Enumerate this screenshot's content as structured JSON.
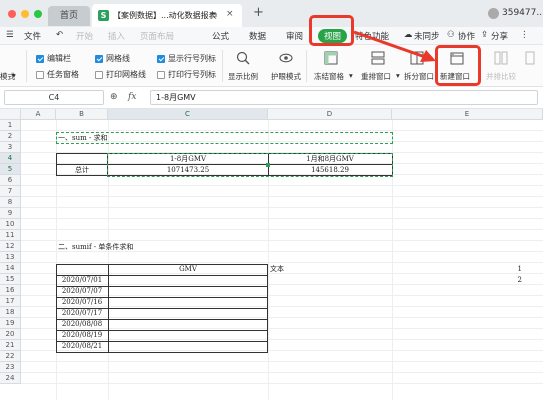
{
  "titlebar": {
    "home_tab": "首页",
    "doc_tab": "【案例数据】...动化数据报表",
    "new_tab": "+",
    "user_id": "359477..."
  },
  "menubar": {
    "file": "文件",
    "items": [
      "开始",
      "插入",
      "页面布局",
      "公式",
      "数据",
      "审阅",
      "视图",
      "特色功能"
    ],
    "sync": "未同步",
    "collab": "协作",
    "share": "分享"
  },
  "ribbon": {
    "mode_label": "模式",
    "edit_bar": "编辑栏",
    "task_pane": "任务窗格",
    "gridlines": "网格线",
    "print_gridlines": "打印网格线",
    "show_headers": "显示行号列标",
    "print_headers": "打印行号列标",
    "zoom": "显示比例",
    "eye_mode": "护眼模式",
    "freeze": "冻结窗格",
    "arrange": "重排窗口",
    "split": "拆分窗口",
    "new_window": "新建窗口",
    "side_by_side": "并排比较"
  },
  "formula_bar": {
    "cell_ref": "C4",
    "fx_label": "fx",
    "value": "1-8月GMV"
  },
  "grid": {
    "columns": [
      "A",
      "B",
      "C",
      "D",
      "E"
    ],
    "rows": [
      "1",
      "2",
      "3",
      "4",
      "5",
      "6",
      "7",
      "8",
      "9",
      "10",
      "11",
      "12",
      "13",
      "14",
      "15",
      "16",
      "17",
      "18",
      "19",
      "20",
      "21",
      "22",
      "23",
      "24"
    ],
    "section1_title": "一、sum - 求和",
    "c4": "1-8月GMV",
    "d4": "1月和8月GMV",
    "b5": "总计",
    "c5": "1071473.25",
    "d5": "145618.29",
    "section2_title": "二、sumif - 单条件求和",
    "c14": "GMV",
    "d14": "文本",
    "e14": "1",
    "e15": "2",
    "dates": [
      "2020/07/01",
      "2020/07/07",
      "2020/07/16",
      "2020/07/17",
      "2020/08/08",
      "2020/08/19",
      "2020/08/21"
    ]
  },
  "colors": {
    "accent_green": "#28a348",
    "annotation_red": "#e8392a",
    "selection_dashed": "#2e9e55"
  }
}
